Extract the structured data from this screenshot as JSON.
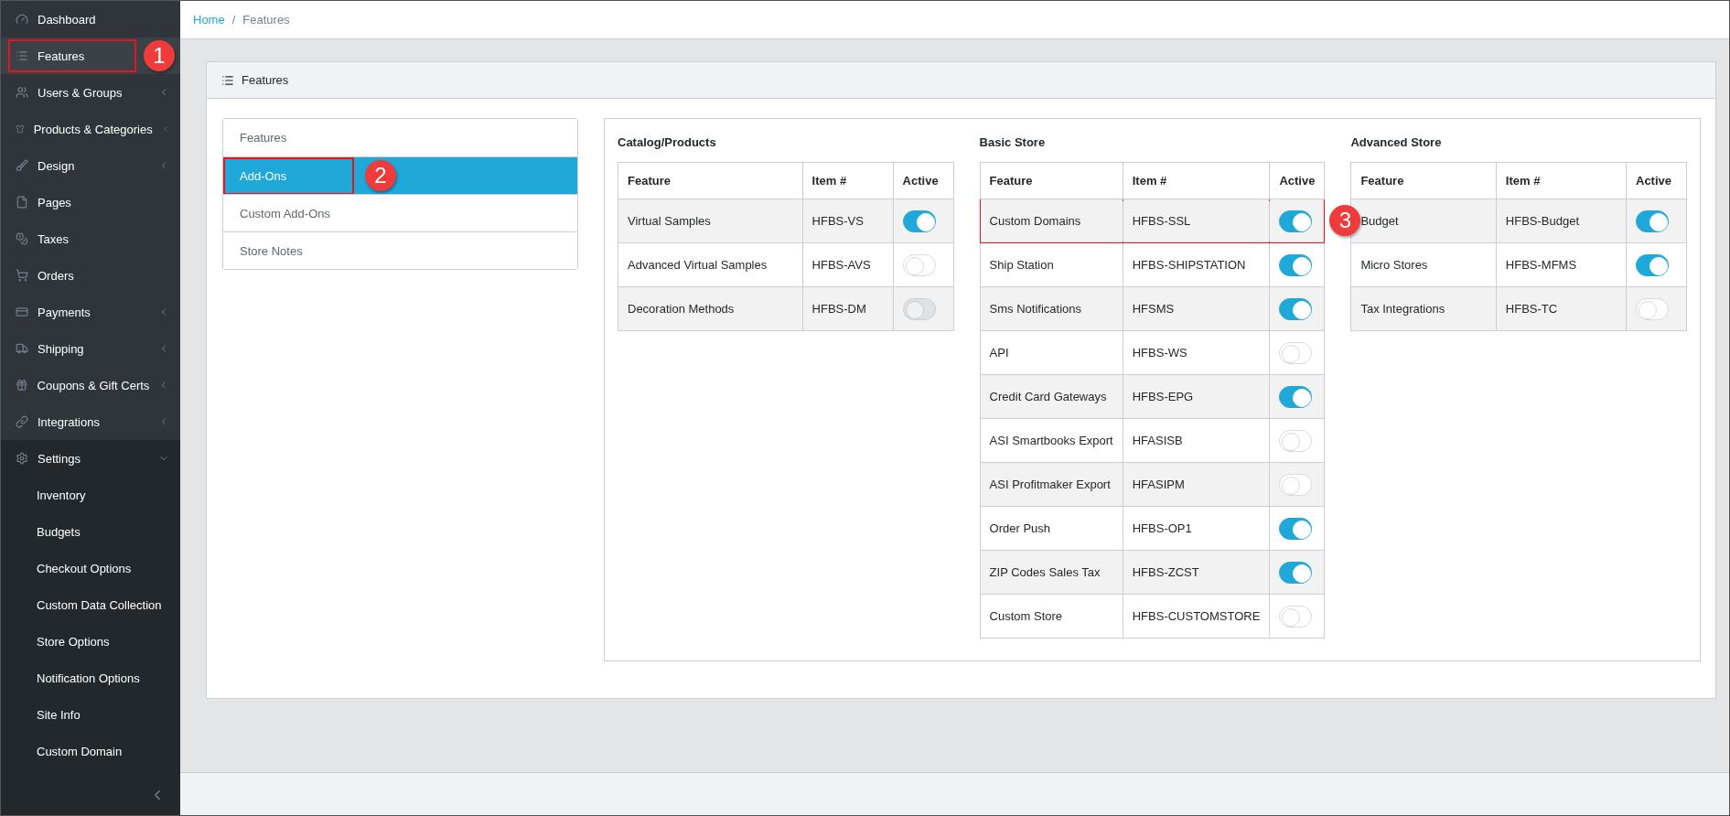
{
  "sidebar": {
    "items": [
      {
        "label": "Dashboard",
        "selected": false,
        "expandable": false
      },
      {
        "label": "Features",
        "selected": true,
        "expandable": false,
        "callout": "1"
      },
      {
        "label": "Users & Groups",
        "selected": false,
        "expandable": true,
        "expanded": false
      },
      {
        "label": "Products & Categories",
        "selected": false,
        "expandable": true,
        "expanded": false
      },
      {
        "label": "Design",
        "selected": false,
        "expandable": true,
        "expanded": false
      },
      {
        "label": "Pages",
        "selected": false,
        "expandable": false
      },
      {
        "label": "Taxes",
        "selected": false,
        "expandable": false
      },
      {
        "label": "Orders",
        "selected": false,
        "expandable": false
      },
      {
        "label": "Payments",
        "selected": false,
        "expandable": true,
        "expanded": false
      },
      {
        "label": "Shipping",
        "selected": false,
        "expandable": true,
        "expanded": false
      },
      {
        "label": "Coupons & Gift Certs",
        "selected": false,
        "expandable": true,
        "expanded": false
      },
      {
        "label": "Integrations",
        "selected": false,
        "expandable": true,
        "expanded": false
      },
      {
        "label": "Settings",
        "selected": false,
        "expandable": true,
        "expanded": true,
        "children": [
          {
            "label": "Inventory",
            "selected": false
          },
          {
            "label": "Budgets",
            "selected": false
          },
          {
            "label": "Checkout Options",
            "selected": false
          },
          {
            "label": "Custom Data Collection",
            "selected": false
          },
          {
            "label": "Store Options",
            "selected": false
          },
          {
            "label": "Notification Options",
            "selected": false
          },
          {
            "label": "Site Info",
            "selected": false
          },
          {
            "label": "Custom Domain",
            "selected": false
          }
        ]
      }
    ]
  },
  "breadcrumb": {
    "separator": "/",
    "items": [
      {
        "label": "Home",
        "link": true
      },
      {
        "label": "Features",
        "link": false
      }
    ]
  },
  "card": {
    "title": "Features"
  },
  "nav_list": [
    {
      "label": "Features",
      "selected": false
    },
    {
      "label": "Add-Ons",
      "selected": true,
      "callout": "2"
    },
    {
      "label": "Custom Add-Ons",
      "selected": false
    },
    {
      "label": "Store Notes",
      "selected": false
    }
  ],
  "tables": [
    {
      "title": "Catalog/Products",
      "columns": [
        "Feature",
        "Item #",
        "Active"
      ],
      "rows": [
        {
          "feature": "Virtual Samples",
          "item": "HFBS-VS",
          "active": true,
          "disabled": false
        },
        {
          "feature": "Advanced Virtual Samples",
          "item": "HFBS-AVS",
          "active": false,
          "disabled": false
        },
        {
          "feature": "Decoration Methods",
          "item": "HFBS-DM",
          "active": false,
          "disabled": true
        }
      ]
    },
    {
      "title": "Basic Store",
      "columns": [
        "Feature",
        "Item #",
        "Active"
      ],
      "rows": [
        {
          "feature": "Custom Domains",
          "item": "HFBS-SSL",
          "active": true,
          "disabled": false,
          "callout": "3"
        },
        {
          "feature": "Ship Station",
          "item": "HFBS-SHIPSTATION",
          "active": true,
          "disabled": false
        },
        {
          "feature": "Sms Notifications",
          "item": "HFSMS",
          "active": true,
          "disabled": false
        },
        {
          "feature": "API",
          "item": "HFBS-WS",
          "active": false,
          "disabled": false
        },
        {
          "feature": "Credit Card Gateways",
          "item": "HFBS-EPG",
          "active": true,
          "disabled": false
        },
        {
          "feature": "ASI Smartbooks Export",
          "item": "HFASISB",
          "active": false,
          "disabled": false
        },
        {
          "feature": "ASI Profitmaker Export",
          "item": "HFASIPM",
          "active": false,
          "disabled": false
        },
        {
          "feature": "Order Push",
          "item": "HFBS-OP1",
          "active": true,
          "disabled": false
        },
        {
          "feature": "ZIP Codes Sales Tax",
          "item": "HFBS-ZCST",
          "active": true,
          "disabled": false
        },
        {
          "feature": "Custom Store",
          "item": "HFBS-CUSTOMSTORE",
          "active": false,
          "disabled": false
        }
      ]
    },
    {
      "title": "Advanced Store",
      "columns": [
        "Feature",
        "Item #",
        "Active"
      ],
      "rows": [
        {
          "feature": "Budget",
          "item": "HFBS-Budget",
          "active": true,
          "disabled": false
        },
        {
          "feature": "Micro Stores",
          "item": "HFBS-MFMS",
          "active": true,
          "disabled": false
        },
        {
          "feature": "Tax Integrations",
          "item": "HFBS-TC",
          "active": false,
          "disabled": false
        }
      ]
    }
  ]
}
